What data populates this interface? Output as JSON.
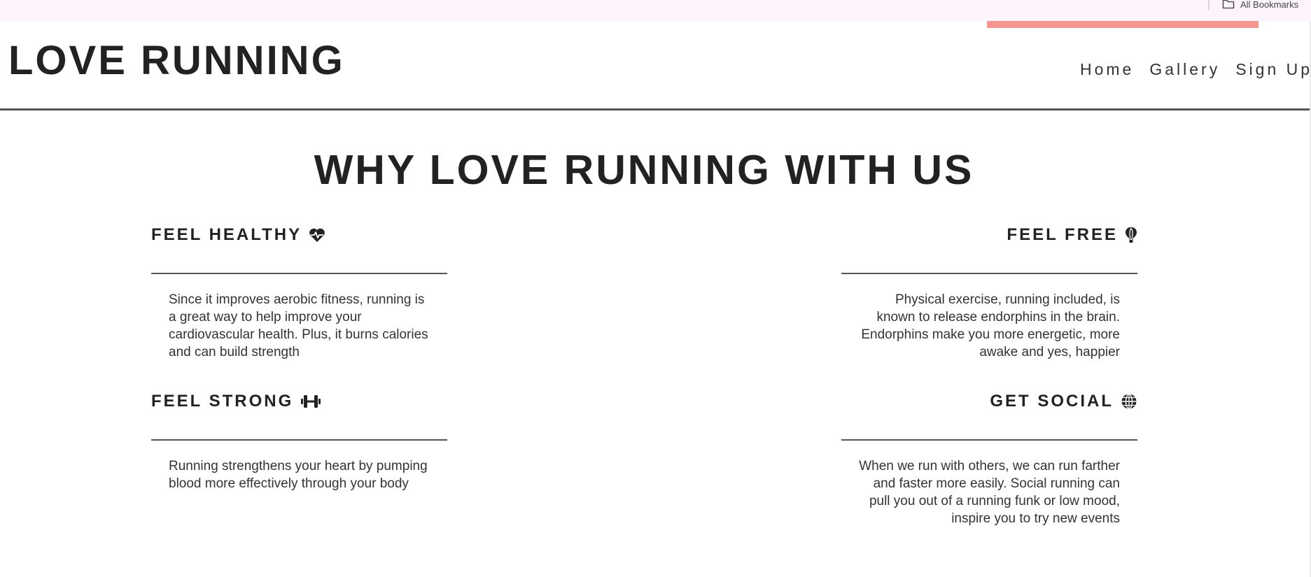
{
  "browser": {
    "all_bookmarks_label": "All Bookmarks"
  },
  "site": {
    "logo": "LOVE RUNNING",
    "accent_color": "#f4958f",
    "nav": [
      {
        "label": "Home",
        "active": true
      },
      {
        "label": "Gallery",
        "active": false
      },
      {
        "label": "Sign Up",
        "active": false
      }
    ]
  },
  "main": {
    "title": "WHY LOVE RUNNING WITH US",
    "features": [
      {
        "heading": "FEEL HEALTHY",
        "icon": "heart-pulse-icon",
        "text": "Since it improves aerobic fitness, running is a great way to help improve your cardiovascular health. Plus, it burns calories and can build strength"
      },
      {
        "heading": "FEEL FREE",
        "icon": "hot-air-balloon-icon",
        "text": "Physical exercise, running included, is known to release endorphins in the brain. Endorphins make you more energetic, more awake and yes, happier"
      },
      {
        "heading": "FEEL STRONG",
        "icon": "dumbbell-icon",
        "text": "Running strengthens your heart by pumping blood more effectively through your body"
      },
      {
        "heading": "GET SOCIAL",
        "icon": "globe-icon",
        "text": "When we run with others, we can run farther and faster more easily. Social running can pull you out of a running funk or low mood, inspire you to try new events"
      }
    ]
  }
}
